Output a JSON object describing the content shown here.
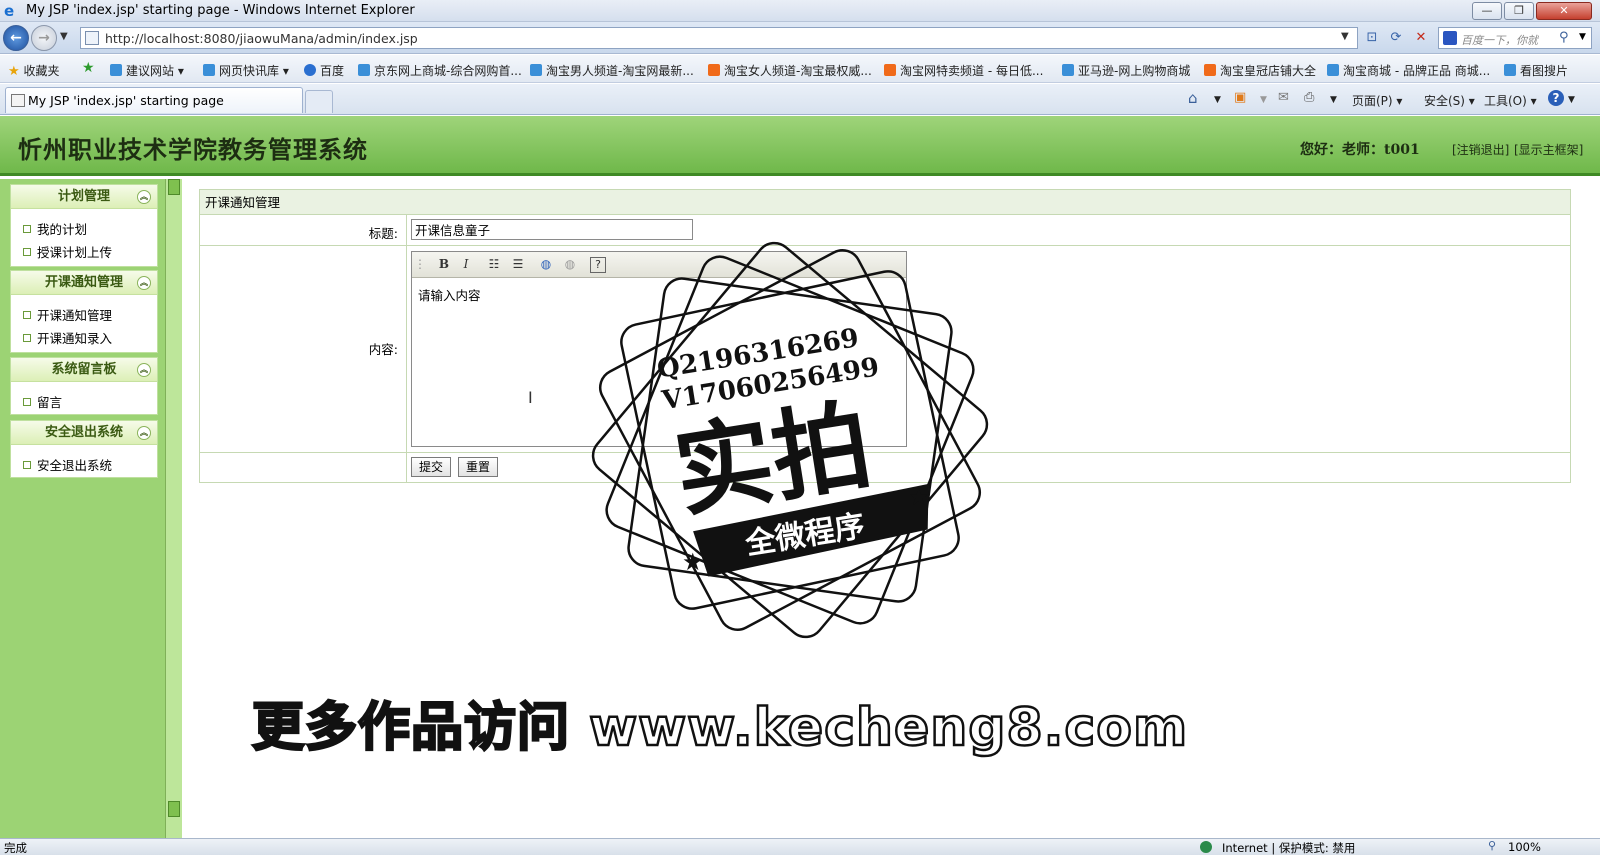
{
  "window": {
    "title": "My JSP 'index.jsp' starting page - Windows Internet Explorer",
    "minimize": "—",
    "restore": "❐",
    "close": "✕"
  },
  "browser": {
    "url": "http://localhost:8080/jiaowuMana/admin/index.jsp",
    "search_placeholder": "百度一下，你就",
    "favorites_label": "收藏夹",
    "favorites": [
      {
        "label": "建议网站 ▾",
        "color": "#3a8fd8"
      },
      {
        "label": "网页快讯库 ▾",
        "color": "#3a8fd8"
      },
      {
        "label": "百度",
        "color": "#2a6fd0"
      },
      {
        "label": "京东网上商城-综合网购首...",
        "color": "#3a8fd8"
      },
      {
        "label": "淘宝男人频道-淘宝网最新...",
        "color": "#3a8fd8"
      },
      {
        "label": "淘宝女人频道-淘宝最权威...",
        "color": "#f06a1a"
      },
      {
        "label": "淘宝网特卖频道 - 每日低...",
        "color": "#f06a1a"
      },
      {
        "label": "亚马逊-网上购物商城",
        "color": "#3a8fd8"
      },
      {
        "label": "淘宝皇冠店铺大全",
        "color": "#f06a1a"
      },
      {
        "label": "淘宝商城 - 品牌正品 商城...",
        "color": "#3a8fd8"
      },
      {
        "label": "看图搜片",
        "color": "#3a8fd8"
      }
    ],
    "tab_title": "My JSP 'index.jsp' starting page",
    "commands": {
      "page": "页面(P) ▾",
      "safety": "安全(S) ▾",
      "tools": "工具(O) ▾"
    },
    "status_text": "完成",
    "status_zone": "Internet | 保护模式: 禁用",
    "status_zoom": "100%"
  },
  "app": {
    "title": "忻州职业技术学院教务管理系统",
    "welcome": "您好：老师：t001",
    "logout": "[注销退出]",
    "show_frame": "[显示主框架]"
  },
  "sidebar": {
    "groups": [
      {
        "title": "计划管理",
        "items": [
          "我的计划",
          "授课计划上传"
        ]
      },
      {
        "title": "开课通知管理",
        "items": [
          "开课通知管理",
          "开课通知录入"
        ]
      },
      {
        "title": "系统留言板",
        "items": [
          "留言"
        ]
      },
      {
        "title": "安全退出系统",
        "items": [
          "安全退出系统"
        ]
      }
    ],
    "toggle_glyph": "︽"
  },
  "form": {
    "panel_title": "开课通知管理",
    "title_label": "标题:",
    "title_value": "开课信息童子",
    "content_label": "内容:",
    "content_placeholder": "请输入内容",
    "submit": "提交",
    "reset": "重置"
  },
  "watermark": {
    "qq": "Q2196316269",
    "v": "V17060256499",
    "big": "实拍",
    "ribbon": "全微程序",
    "banner": "更多作品访问 www.kecheng8.com"
  }
}
